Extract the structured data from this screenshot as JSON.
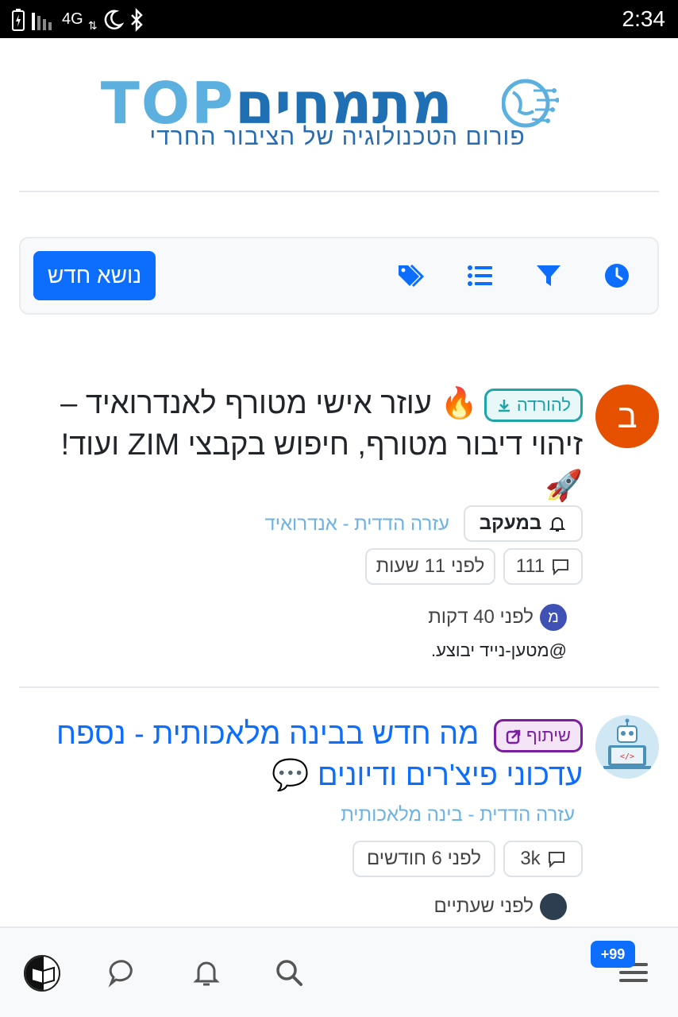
{
  "status_bar": {
    "network": "4G",
    "time": "2:34"
  },
  "logo": {
    "top": "TOP",
    "hebrew": "מתמחים",
    "subtitle": "פורום הטכנולוגיה של הציבור החרדי"
  },
  "toolbar": {
    "new_topic": "נושא חדש",
    "icons": [
      "clock-icon",
      "filter-icon",
      "list-icon",
      "tags-icon"
    ]
  },
  "topics": [
    {
      "avatar_letter": "ב",
      "avatar_color": "#e65100",
      "badge": "להורדה",
      "title": "עוזר אישי מטורף לאנדרואיד – זיהוי דיבור מטורף, חיפוש בקבצי ZIM ועוד!",
      "title_emoji_start": "🔥",
      "title_emoji_end": "🚀",
      "watch_label": "במעקב",
      "category": "עזרה הדדית - אנדרואיד",
      "replies": "111",
      "time_ago": "לפני 11 שעות",
      "last_user_letter": "מ",
      "last_time": "לפני 40 דקות",
      "snippet": "@מטען-נייד יבוצע."
    },
    {
      "badge": "שיתוף",
      "title": "מה חדש בבינה מלאכותית - נספח עדכוני פיצ'רים ודיונים",
      "title_emoji_end": "💬",
      "category": "עזרה הדדית - בינה מלאכותית",
      "replies": "3k",
      "time_ago": "לפני 6 חודשים",
      "last_time": "לפני שעתיים"
    }
  ],
  "bottom_nav": {
    "badge": "+99"
  },
  "colors": {
    "primary": "#0d6efd",
    "teal": "#20a4a8",
    "purple": "#7b1fa2",
    "category": "#6cb3e3"
  }
}
